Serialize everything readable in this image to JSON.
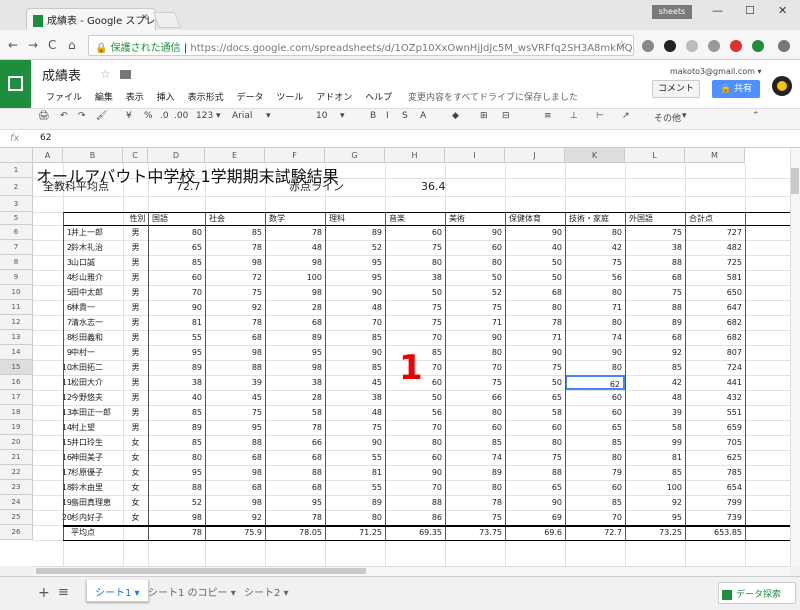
{
  "browser": {
    "tab_title": "成績表 - Google スプレッドシー",
    "tab_close": "×",
    "user_badge": "sheets",
    "window_controls": [
      "—",
      "☐",
      "✕"
    ],
    "nav": [
      "←",
      "→",
      "C",
      "⌂"
    ],
    "security": "保護された通信",
    "url": "https://docs.google.com/spreadsheets/d/1OZp10XxOwnHjJdJc5M_wsVRFfq2SH3A8mkMQEvVkL",
    "star": "☆",
    "ext_colors": [
      "#888888",
      "#222222",
      "#bbbbbb",
      "#999999",
      "#dd3333",
      "#1e8e3e",
      "#777777"
    ]
  },
  "app": {
    "doc_title": "成績表",
    "title_star": "☆",
    "menus": [
      "ファイル",
      "編集",
      "表示",
      "挿入",
      "表示形式",
      "データ",
      "ツール",
      "アドオン",
      "ヘルプ"
    ],
    "save_status": "変更内容をすべてドライブに保存しました",
    "account": "makoto3@gmail.com ▾",
    "comment_label": "コメント",
    "share_label": "🔒 共有",
    "brand_color": "#1e8e3e",
    "accent_color": "#4285f4"
  },
  "toolbar": {
    "items": [
      "🖨",
      "↶",
      "↷",
      "🖌",
      "¥",
      "%",
      ".0",
      ".00",
      "123 ▾",
      "Arial",
      "▾",
      "10",
      "▾",
      "B",
      "I",
      "S",
      "A",
      "◆",
      "⊞",
      "⊟",
      "≡",
      "⊥",
      "⊢",
      "↗",
      "その他",
      "▾",
      "⌃"
    ]
  },
  "formula": {
    "fx": "fx",
    "value": "62"
  },
  "sheet": {
    "columns": [
      "A",
      "B",
      "C",
      "D",
      "E",
      "F",
      "G",
      "H",
      "I",
      "J",
      "K",
      "L",
      "M"
    ],
    "selected_column": "K",
    "selected_row": "15",
    "row_numbers": [
      "1",
      "2",
      "3",
      "5",
      "6",
      "7",
      "8",
      "9",
      "10",
      "11",
      "12",
      "13",
      "14",
      "15",
      "16",
      "17",
      "18",
      "19",
      "20",
      "21",
      "22",
      "23",
      "24",
      "25",
      "26"
    ],
    "title": "オールアバウト中学校 1学期期末試験結果",
    "summary": {
      "avg_label": "全教科平均点",
      "avg_value": "72.7",
      "fail_label": "赤点ライン",
      "fail_value": "36.4"
    },
    "headers": [
      "性別",
      "国語",
      "社会",
      "数学",
      "理科",
      "音楽",
      "美術",
      "保健体育",
      "技術・家庭",
      "外国語",
      "合計点"
    ],
    "students": [
      [
        "1",
        "井上一郎",
        "男",
        "80",
        "85",
        "78",
        "89",
        "60",
        "90",
        "90",
        "80",
        "75",
        "727"
      ],
      [
        "2",
        "鈴木礼治",
        "男",
        "65",
        "78",
        "48",
        "52",
        "75",
        "60",
        "40",
        "42",
        "38",
        "482"
      ],
      [
        "3",
        "山口誠",
        "男",
        "85",
        "98",
        "98",
        "95",
        "80",
        "80",
        "50",
        "75",
        "88",
        "725"
      ],
      [
        "4",
        "杉山雅介",
        "男",
        "60",
        "72",
        "100",
        "95",
        "38",
        "50",
        "50",
        "56",
        "68",
        "581"
      ],
      [
        "5",
        "田中太郎",
        "男",
        "70",
        "75",
        "98",
        "90",
        "50",
        "52",
        "68",
        "80",
        "75",
        "650"
      ],
      [
        "6",
        "林貴一",
        "男",
        "90",
        "92",
        "28",
        "48",
        "75",
        "75",
        "80",
        "71",
        "88",
        "647"
      ],
      [
        "7",
        "清水志一",
        "男",
        "81",
        "78",
        "68",
        "70",
        "75",
        "71",
        "78",
        "80",
        "89",
        "682"
      ],
      [
        "8",
        "杉田義和",
        "男",
        "55",
        "68",
        "89",
        "85",
        "70",
        "90",
        "71",
        "74",
        "68",
        "682"
      ],
      [
        "9",
        "中村一",
        "男",
        "95",
        "98",
        "95",
        "90",
        "85",
        "80",
        "90",
        "90",
        "92",
        "807"
      ],
      [
        "10",
        "木田拓二",
        "男",
        "89",
        "88",
        "98",
        "85",
        "70",
        "70",
        "75",
        "80",
        "85",
        "724"
      ],
      [
        "11",
        "松田大介",
        "男",
        "38",
        "39",
        "38",
        "45",
        "60",
        "75",
        "50",
        "62",
        "42",
        "441"
      ],
      [
        "12",
        "今野悠夫",
        "男",
        "40",
        "45",
        "28",
        "38",
        "50",
        "66",
        "65",
        "60",
        "48",
        "432"
      ],
      [
        "13",
        "本田正一郎",
        "男",
        "85",
        "75",
        "58",
        "48",
        "56",
        "80",
        "58",
        "60",
        "39",
        "551"
      ],
      [
        "14",
        "村上望",
        "男",
        "89",
        "95",
        "78",
        "75",
        "70",
        "60",
        "60",
        "65",
        "58",
        "659"
      ],
      [
        "15",
        "井口玲生",
        "女",
        "85",
        "88",
        "66",
        "90",
        "80",
        "85",
        "80",
        "85",
        "99",
        "705"
      ],
      [
        "16",
        "神田美子",
        "女",
        "80",
        "68",
        "68",
        "55",
        "60",
        "74",
        "75",
        "80",
        "81",
        "625"
      ],
      [
        "17",
        "杉原優子",
        "女",
        "95",
        "98",
        "88",
        "81",
        "90",
        "89",
        "88",
        "79",
        "85",
        "785"
      ],
      [
        "18",
        "鈴木由里",
        "女",
        "88",
        "68",
        "68",
        "55",
        "70",
        "80",
        "65",
        "60",
        "100",
        "654"
      ],
      [
        "19",
        "島田真理恵",
        "女",
        "52",
        "98",
        "95",
        "89",
        "88",
        "78",
        "90",
        "85",
        "92",
        "799"
      ],
      [
        "20",
        "杉内好子",
        "女",
        "98",
        "92",
        "78",
        "80",
        "86",
        "75",
        "69",
        "70",
        "95",
        "739"
      ]
    ],
    "average": [
      "平均点",
      "78",
      "75.9",
      "78.05",
      "71.25",
      "69.35",
      "73.75",
      "69.6",
      "72.7",
      "73.25",
      "653.85"
    ],
    "annotation": "1"
  },
  "footer": {
    "add_sheet": "+",
    "all_sheets": "≡",
    "tabs": [
      "シート1 ▾",
      "シート1 のコピー ▾",
      "シート2 ▾"
    ],
    "active_tab": 0,
    "explore_label": "データ探索"
  }
}
